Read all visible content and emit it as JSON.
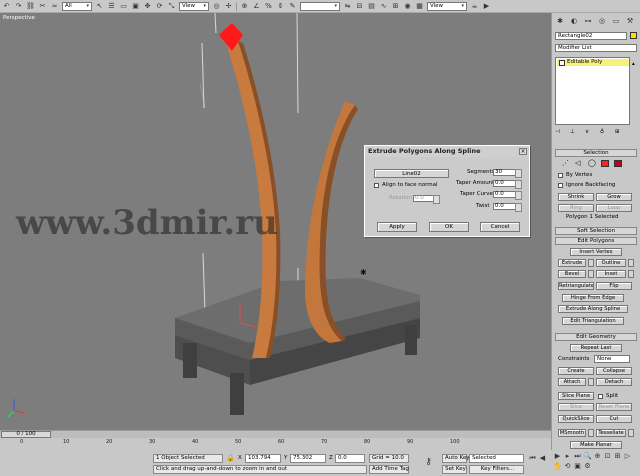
{
  "toolbar": {
    "selection_filter": "All",
    "ref_coord": "View",
    "ref_coord_2": "View"
  },
  "viewport": {
    "label": "Perspective",
    "watermark": "www.3dmir.ru"
  },
  "dialog": {
    "title": "Extrude Polygons Along Spline",
    "spline_button": "Line02",
    "align_label": "Align to face normal",
    "rotation_label": "Rotation",
    "rotation_value": "0.0",
    "segments_label": "Segments",
    "segments_value": "30",
    "taper_amount_label": "Taper Amount",
    "taper_amount_value": "0.0",
    "taper_curve_label": "Taper Curve",
    "taper_curve_value": "0.0",
    "twist_label": "Twist",
    "twist_value": "0.0",
    "apply_button": "Apply",
    "ok_button": "OK",
    "cancel_button": "Cancel"
  },
  "panel": {
    "object_name": "Rectangle02",
    "modifier_list": "Modifier List",
    "stack_item": "Editable Poly",
    "selection_rollout": "Selection",
    "by_vertex": "By Vertex",
    "ignore_backfacing": "Ignore Backfacing",
    "shrink": "Shrink",
    "grow": "Grow",
    "ring": "Ring",
    "loop": "Loop",
    "selected_count": "Polygon 1 Selected",
    "soft_selection": "Soft Selection",
    "edit_polygons": "Edit Polygons",
    "insert_vertex": "Insert Vertex",
    "extrude": "Extrude",
    "outline": "Outline",
    "bevel": "Bevel",
    "inset": "Inset",
    "retriangulate": "Retriangulate",
    "flip": "Flip",
    "hinge_from_edge": "Hinge From Edge",
    "extrude_along_spline": "Extrude Along Spline",
    "edit_triangulation": "Edit Triangulation",
    "edit_geometry": "Edit Geometry",
    "repeat_last": "Repeat Last",
    "constraints_label": "Constraints",
    "constraints_value": "None",
    "create": "Create",
    "collapse": "Collapse",
    "attach": "Attach",
    "detach": "Detach",
    "slice_plane": "Slice Plane",
    "split": "Split",
    "slice": "Slice",
    "reset_plane": "Reset Plane",
    "quickslice": "QuickSlice",
    "cut": "Cut",
    "msmooth": "MSmooth",
    "tessellate": "Tessellate",
    "make_planar": "Make Planar",
    "colors": {
      "object_swatch": "#ffe000",
      "stack_highlight": "#f7f17a"
    }
  },
  "timeline": {
    "frame": "0 / 100",
    "ticks": [
      "0",
      "10",
      "20",
      "30",
      "40",
      "50",
      "60",
      "70",
      "80",
      "90",
      "100"
    ]
  },
  "status": {
    "selection": "1 Object Selected",
    "prompt": "Click and drag up-and-down to zoom in and out",
    "x_label": "X",
    "x_value": "103.794",
    "y_label": "Y",
    "y_value": "75.302",
    "z_label": "Z",
    "z_value": "0.0",
    "grid": "Grid = 10.0",
    "add_time_tag": "Add Time Tag",
    "auto_key": "Auto Key",
    "set_key": "Set Key",
    "key_mode": "Selected",
    "key_filters": "Key Filters..."
  }
}
